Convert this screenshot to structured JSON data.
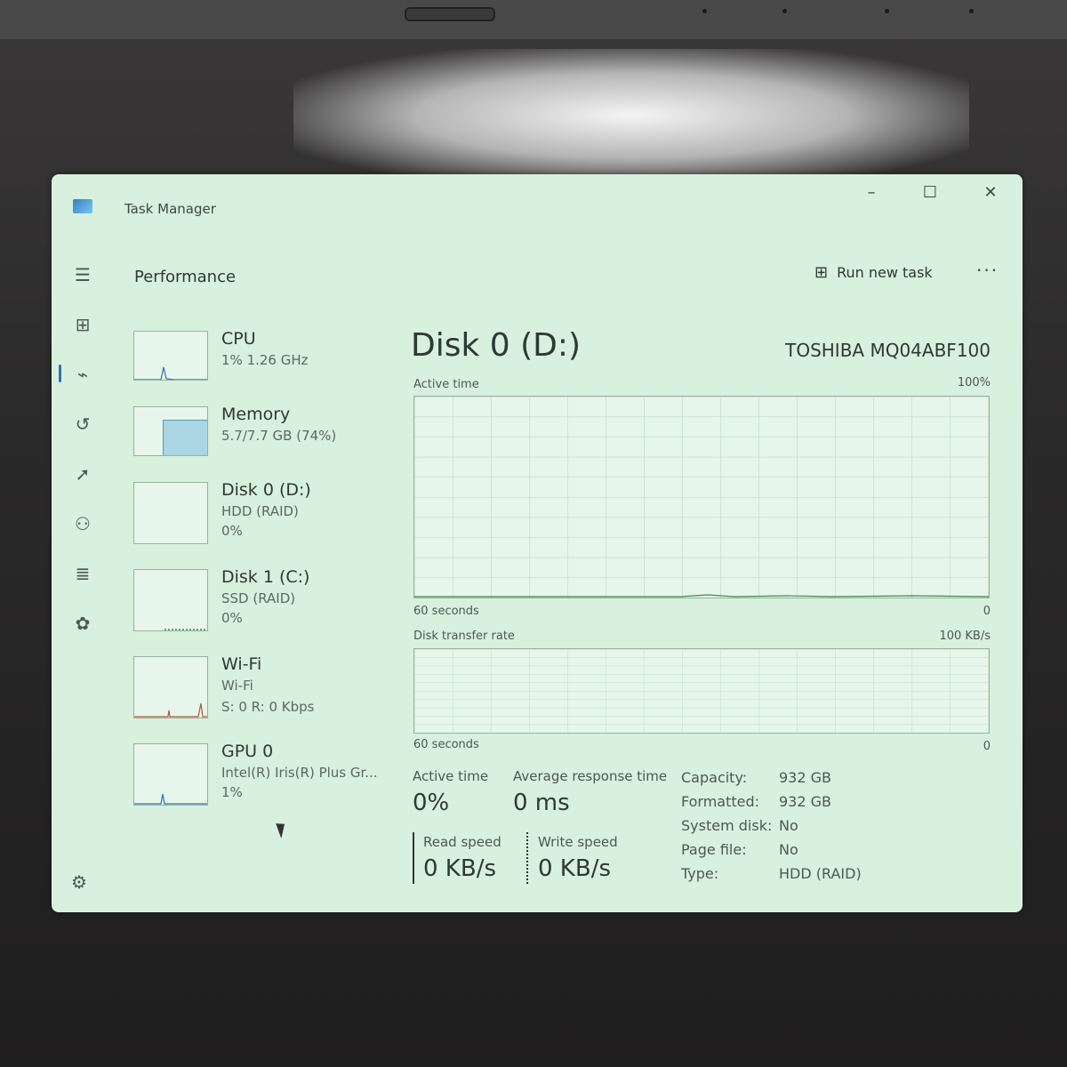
{
  "window": {
    "title": "Task Manager"
  },
  "header": {
    "section": "Performance",
    "run_new_task": "Run new task"
  },
  "devices": [
    {
      "name": "CPU",
      "line2": "1% 1.26 GHz",
      "line3": ""
    },
    {
      "name": "Memory",
      "line2": "5.7/7.7 GB (74%)",
      "line3": ""
    },
    {
      "name": "Disk 0 (D:)",
      "line2": "HDD (RAID)",
      "line3": "0%"
    },
    {
      "name": "Disk 1 (C:)",
      "line2": "SSD (RAID)",
      "line3": "0%"
    },
    {
      "name": "Wi-Fi",
      "line2": "Wi-Fi",
      "line3": "S: 0 R: 0 Kbps"
    },
    {
      "name": "GPU 0",
      "line2": "Intel(R) Iris(R) Plus Gr...",
      "line3": "1%"
    }
  ],
  "detail": {
    "title": "Disk 0 (D:)",
    "model": "TOSHIBA MQ04ABF100",
    "graph1": {
      "label": "Active time",
      "max": "100%",
      "time": "60 seconds",
      "min": "0"
    },
    "graph2": {
      "label": "Disk transfer rate",
      "max": "100 KB/s",
      "time": "60 seconds",
      "min": "0"
    },
    "stats": {
      "active_time_label": "Active time",
      "active_time": "0%",
      "avg_resp_label": "Average response time",
      "avg_resp": "0 ms",
      "read_label": "Read speed",
      "read": "0 KB/s",
      "write_label": "Write speed",
      "write": "0 KB/s"
    },
    "props": [
      {
        "k": "Capacity:",
        "v": "932 GB"
      },
      {
        "k": "Formatted:",
        "v": "932 GB"
      },
      {
        "k": "System disk:",
        "v": "No"
      },
      {
        "k": "Page file:",
        "v": "No"
      },
      {
        "k": "Type:",
        "v": "HDD (RAID)"
      }
    ]
  },
  "colors": {
    "accent": "#2f6fb0",
    "window_bg": "#d8f0de",
    "graph_line": "#3c8a4a",
    "memory_fill": "#a9d6e2"
  }
}
